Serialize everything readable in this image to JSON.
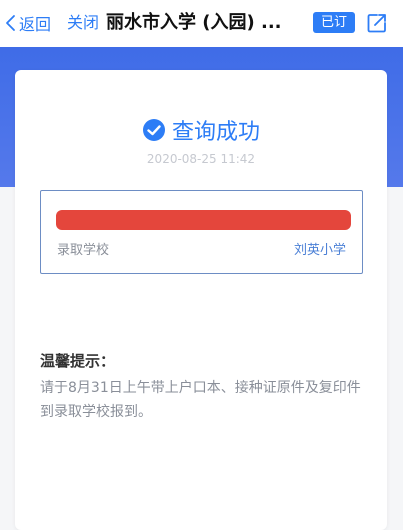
{
  "nav": {
    "back_label": "返回",
    "close_label": "关闭",
    "title": "丽水市入学 (入园) ...",
    "subscribe_badge": "已订"
  },
  "result": {
    "status": "查询成功",
    "timestamp": "2020-08-25 11:42",
    "school_label": "录取学校",
    "school_value": "刘英小学"
  },
  "tips": {
    "title": "温馨提示：",
    "body": "请于8月31日上午带上户口本、接种证原件及复印件到录取学校报到。"
  },
  "colors": {
    "accent": "#2d7df6",
    "hero": "#4a72e9",
    "redaction": "#e4463c"
  },
  "icons": [
    "chevron-left-icon",
    "share-icon",
    "check-circle-icon"
  ]
}
